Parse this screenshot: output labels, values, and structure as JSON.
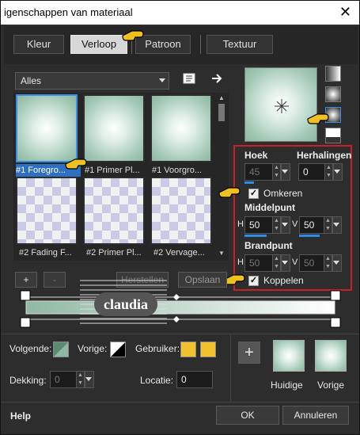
{
  "window": {
    "title": "igenschappen van materiaal",
    "close_glyph": "✕"
  },
  "tabs": [
    {
      "label": "Kleur"
    },
    {
      "label": "Verloop"
    },
    {
      "label": "Patroon"
    },
    {
      "label": "Textuur"
    }
  ],
  "category": {
    "selected": "Alles"
  },
  "thumbnails": [
    {
      "label": "#1 Foregro..."
    },
    {
      "label": "#1 Primer Pl..."
    },
    {
      "label": "#1 Voorgro..."
    },
    {
      "label": "#2 Fading F..."
    },
    {
      "label": "#2 Primer Pl..."
    },
    {
      "label": "#2 Vervage..."
    }
  ],
  "controls": {
    "add": "+",
    "remove": "-",
    "restore": "Herstellen",
    "save": "Opslaan"
  },
  "settings": {
    "angle_label": "Hoek",
    "angle_value": "45",
    "repeats_label": "Herhalingen",
    "repeats_value": "0",
    "invert_label": "Omkeren",
    "invert_checked": true,
    "center_label": "Middelpunt",
    "center_h": "50",
    "center_v": "50",
    "focal_label": "Brandpunt",
    "focal_h": "50",
    "focal_v": "50",
    "link_label": "Koppelen",
    "link_checked": true,
    "h_letter": "H",
    "v_letter": "V"
  },
  "watermark": {
    "text": "claudia"
  },
  "bottom": {
    "next_label": "Volgende:",
    "prev_label": "Vorige:",
    "user_label": "Gebruiker:",
    "opacity_label": "Dekking:",
    "opacity_value": "0",
    "location_label": "Locatie:",
    "location_value": "0",
    "current_label": "Huidige",
    "previous_label": "Vorige",
    "help": "Help",
    "ok": "OK",
    "cancel": "Annuleren"
  },
  "colors": {
    "gradient_start": "#8fb8a3",
    "gradient_end": "#ffffff",
    "accent": "#2d8ce6",
    "user_swatch": "#f2c12e",
    "highlight_border": "#c8202a"
  }
}
